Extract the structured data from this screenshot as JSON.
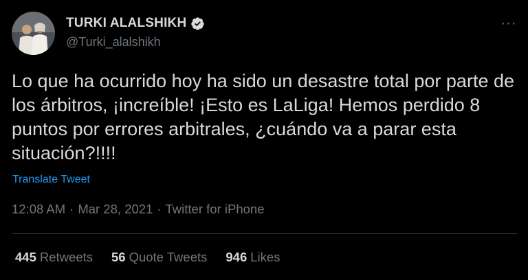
{
  "author": {
    "display_name": "TURKI ALALSHIKH",
    "handle": "@Turki_alalshikh",
    "verified_icon": "verified-badge-icon"
  },
  "tweet": {
    "text": "Lo que ha ocurrido hoy ha sido un desastre total por parte de los árbitros, ¡increíble! ¡Esto es LaLiga! Hemos perdido 8 puntos por errores arbitrales, ¿cuándo va a parar esta situación?!!!!",
    "translate_label": "Translate Tweet",
    "time": "12:08 AM",
    "separator": "·",
    "date": "Mar 28, 2021",
    "source": "Twitter for iPhone"
  },
  "more_icon": "more-options-icon",
  "more_label": "···",
  "stats": {
    "retweets_count": "445",
    "retweets_label": "Retweets",
    "quotes_count": "56",
    "quotes_label": "Quote Tweets",
    "likes_count": "946",
    "likes_label": "Likes"
  },
  "colors": {
    "background": "#000000",
    "text": "#d9d9d9",
    "secondary": "#6e767d",
    "accent": "#1d9bf0",
    "divider": "#2f3336"
  }
}
